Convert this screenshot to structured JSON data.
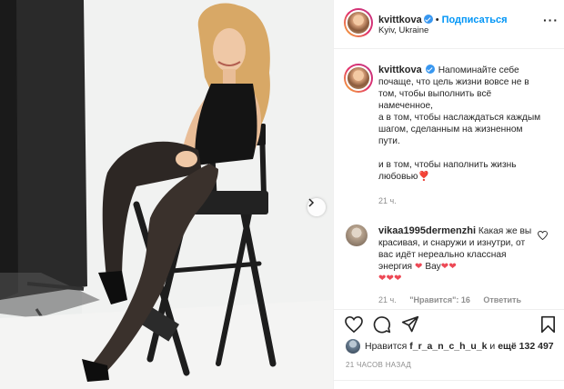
{
  "header": {
    "username": "kvittkova",
    "separator": "•",
    "follow_label": "Подписаться",
    "location": "Kyiv, Ukraine",
    "more_label": "···"
  },
  "caption": {
    "username": "kvittkova",
    "text": "Напоминайте себе почаще, что цель жизни вовсе не в том, чтобы выполнить всё намеченное,\nа в том, чтобы наслаждаться каждым шагом, сделанным на жизненном пути.\n\nи в том, чтобы наполнить жизнь любовью",
    "emoji": "❣️",
    "time": "21 ч."
  },
  "comment": {
    "username": "vikaa1995dermenzhi",
    "text": "Какая же вы красивая, и снаружи и изнутри, от вас идёт нереально классная энергия",
    "hearts_inline": "❤",
    "wow": "Вау",
    "hearts_trail": "❤❤",
    "hearts_line2": "❤❤❤",
    "time": "21 ч.",
    "likes_label": "\"Нравится\": 16",
    "reply_label": "Ответить"
  },
  "likes": {
    "prefix": "Нравится",
    "liker": "f_r_a_n_c_h_u_k",
    "joiner": "и",
    "others": "ещё 132 497"
  },
  "timestamp": "21 ЧАСОВ НАЗАД",
  "icons": {
    "like": "heart-icon",
    "comment": "comment-icon",
    "share": "paper-plane-icon",
    "save": "bookmark-icon",
    "next": "chevron-right-icon"
  },
  "colors": {
    "follow": "#0095f6",
    "verified": "#3897f0",
    "heart": "#ed4956",
    "muted": "#8e8e8e"
  }
}
